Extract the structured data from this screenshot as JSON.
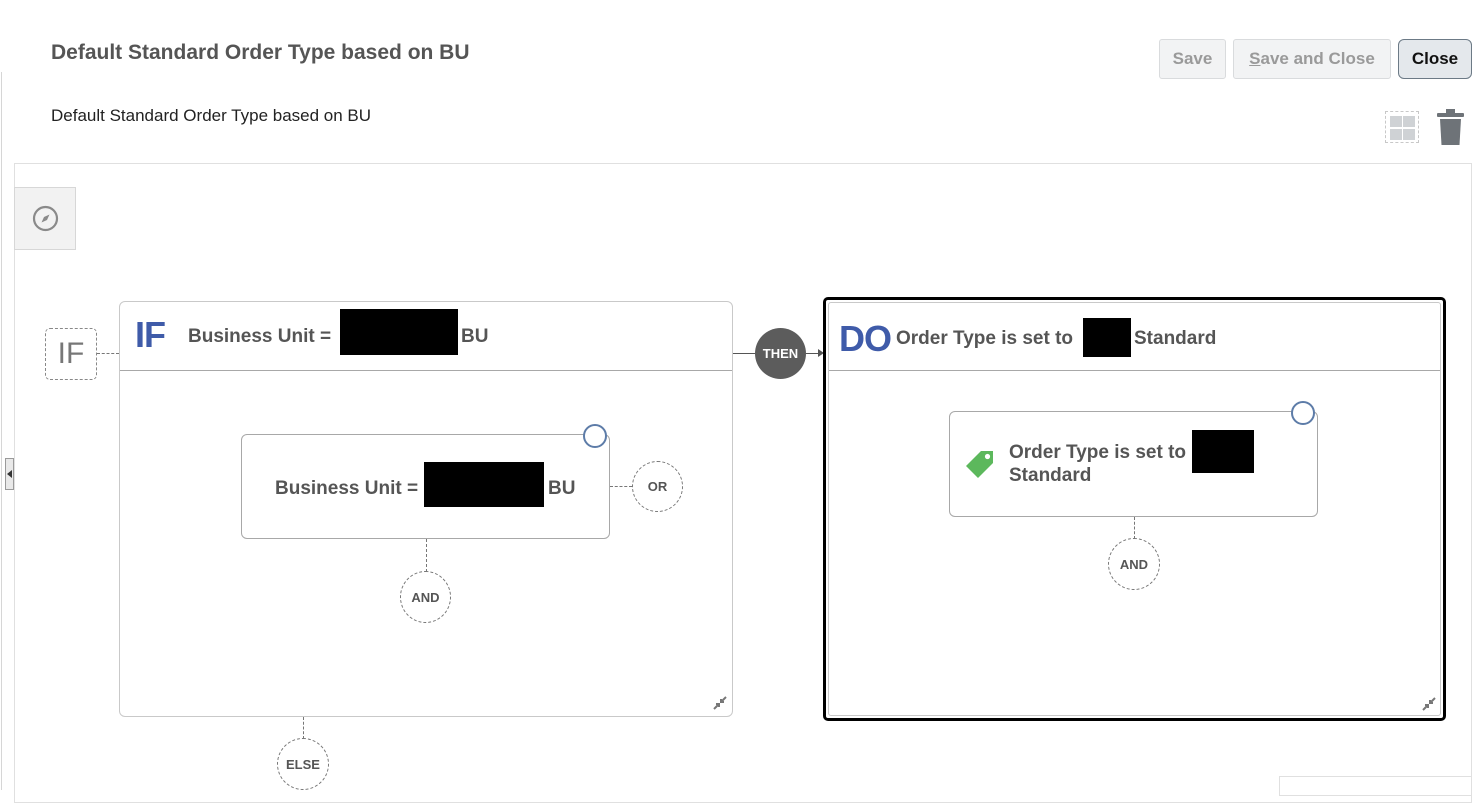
{
  "header": {
    "title": "Default Standard Order Type based on BU",
    "description": "Default Standard Order Type based on BU"
  },
  "toolbar": {
    "save_label": "Save",
    "save_close_label": "Save and Close",
    "close_label": "Close"
  },
  "icons": {
    "layout": "grid-layout-icon",
    "delete": "trash-icon",
    "navigator": "compass-icon",
    "collapse": "collapse-arrow-icon",
    "resize": "resize-icon",
    "tag": "tag-icon"
  },
  "rule": {
    "if_marker": "IF",
    "if_keyword": "IF",
    "if_condition_prefix": "Business Unit =",
    "if_condition_suffix": "BU",
    "condition_card_prefix": "Business Unit =",
    "condition_card_suffix": "BU",
    "or_label": "OR",
    "and_label_if": "AND",
    "else_label": "ELSE",
    "then_label": "THEN",
    "do_keyword": "DO",
    "do_action_prefix": "Order Type is set to",
    "do_action_suffix": "Standard",
    "action_card_line1": "Order Type is set to",
    "action_card_line2": "Standard",
    "and_label_do": "AND"
  },
  "colors": {
    "keyword_blue": "#3f5ba9",
    "then_bg": "#5c5c5c",
    "tag_green": "#5cb85c",
    "selected_border": "#000000",
    "ring_blue": "#5d7ca8"
  }
}
